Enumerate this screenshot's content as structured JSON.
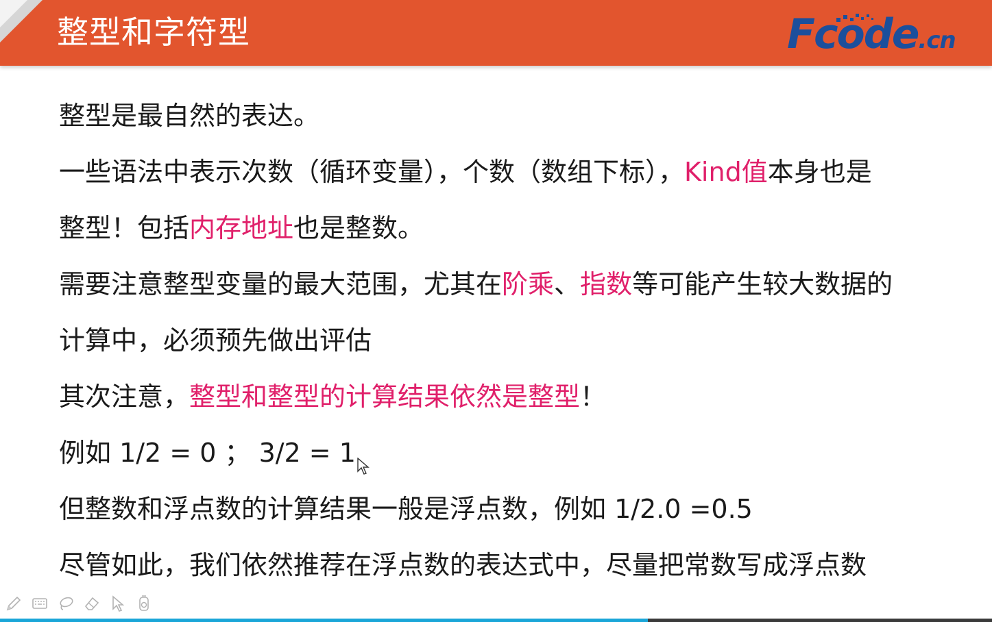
{
  "slide": {
    "title": "整型和字符型",
    "logo": {
      "brand": "Fcode",
      "tld": ".cn"
    },
    "lines": [
      [
        {
          "text": "整型是最自然的表达。",
          "hl": false
        }
      ],
      [
        {
          "text": "一些语法中表示次数（循环变量），个数（数组下标），",
          "hl": false
        },
        {
          "text": "Kind值",
          "hl": true
        },
        {
          "text": "本身也是",
          "hl": false
        }
      ],
      [
        {
          "text": "整型！包括",
          "hl": false
        },
        {
          "text": "内存地址",
          "hl": true
        },
        {
          "text": "也是整数。",
          "hl": false
        }
      ],
      [
        {
          "text": "需要注意整型变量的最大范围，尤其在",
          "hl": false
        },
        {
          "text": "阶乘",
          "hl": true
        },
        {
          "text": "、",
          "hl": false
        },
        {
          "text": "指数",
          "hl": true
        },
        {
          "text": "等可能产生较大数据的",
          "hl": false
        }
      ],
      [
        {
          "text": "计算中，必须预先做出评估",
          "hl": false
        }
      ],
      [
        {
          "text": "其次注意，",
          "hl": false
        },
        {
          "text": "整型和整型的计算结果依然是整型",
          "hl": true
        },
        {
          "text": "！",
          "hl": false
        }
      ],
      [
        {
          "text": "例如 1/2 = 0 ； 3/2 = 1",
          "hl": false
        }
      ],
      [
        {
          "text": "但整数和浮点数的计算结果一般是浮点数，例如 1/2.0 =0.5",
          "hl": false
        }
      ],
      [
        {
          "text": "尽管如此，我们依然推荐在浮点数的表达式中，尽量把常数写成浮点数",
          "hl": false
        }
      ]
    ]
  },
  "toolbar": {
    "tools": [
      "pen-icon",
      "keyboard-icon",
      "lasso-icon",
      "eraser-icon",
      "pointer-icon",
      "camera-icon"
    ]
  },
  "colors": {
    "header": "#e2552e",
    "highlight": "#e0206a",
    "logo": "#1c4f9c",
    "progress": "#1aa6d8"
  }
}
